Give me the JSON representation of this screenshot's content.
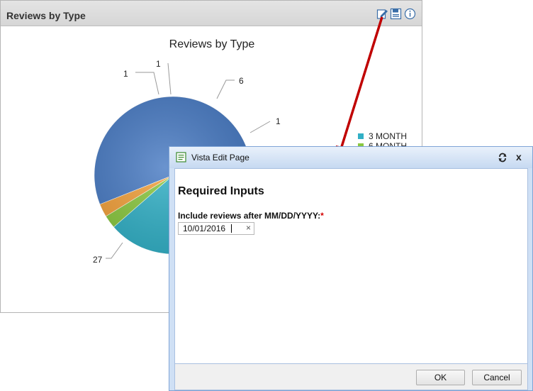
{
  "panel": {
    "title": "Reviews by Type",
    "icons": [
      "edit-icon",
      "save-icon",
      "info-icon"
    ]
  },
  "chart_data": {
    "type": "pie",
    "title": "Reviews by Type",
    "slices": [
      {
        "label": "27",
        "value": 27,
        "color": "#4a7cc4"
      },
      {
        "label": "1",
        "value": 1,
        "color": "#b2507e"
      },
      {
        "label": "1",
        "value": 1,
        "color": "#43a68e"
      },
      {
        "label": "6",
        "value": 6,
        "color": "#32b0c6"
      },
      {
        "label": "1",
        "value": 1,
        "color": "#8ac840"
      },
      {
        "label": "",
        "value": 1,
        "color": "#f2a13c"
      }
    ],
    "legend": {
      "placement": "right",
      "entries": [
        {
          "name": "3 MONTH",
          "color": "#32b0c6"
        },
        {
          "name": "6 MONTH",
          "color": "#8ac840"
        }
      ]
    }
  },
  "dialog": {
    "title": "Vista Edit Page",
    "section_title": "Required Inputs",
    "field_label": "Include reviews after MM/DD/YYYY:",
    "required_mark": "*",
    "date_value": "10/01/2016",
    "clear_glyph": "×",
    "close_glyph": "x",
    "ok_label": "OK",
    "cancel_label": "Cancel"
  },
  "colors": {
    "arrow": "#c00000",
    "dialog_frame": "#cfe0f5",
    "required": "#d40000"
  }
}
